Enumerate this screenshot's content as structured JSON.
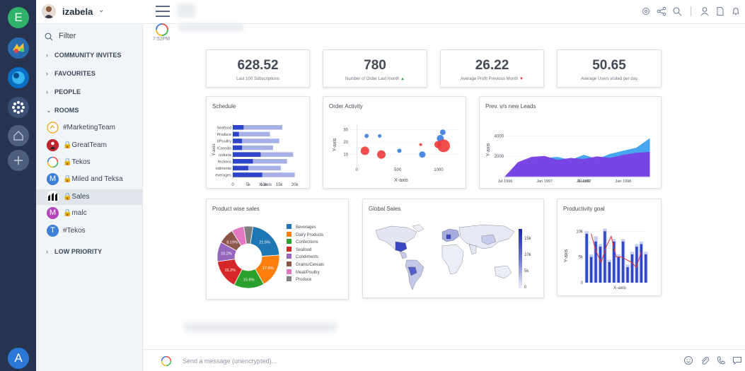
{
  "rail": {
    "top_space_letter": "E",
    "bottom_space_letter": "A",
    "colors": {
      "top_space": "#2fb36b",
      "bottom_space": "#2b78d6"
    }
  },
  "user": {
    "name": "izabela"
  },
  "filter": {
    "label": "Filter"
  },
  "sections": {
    "community_invites": "COMMUNITY INVITES",
    "favourites": "FAVOURITES",
    "people": "PEOPLE",
    "rooms": "ROOMS",
    "low_priority": "LOW PRIORITY"
  },
  "rooms": [
    {
      "name": "#MarketingTeam",
      "avatar_letter": "",
      "color": "#f5a524",
      "locked": false
    },
    {
      "name": "GreatTeam",
      "avatar_letter": "",
      "color": "#d02e2e",
      "locked": true
    },
    {
      "name": "Tekos",
      "avatar_letter": "",
      "color": "#4a90d9",
      "locked": true
    },
    {
      "name": "Miled and Teksa",
      "avatar_letter": "M",
      "color": "#3e7fd8",
      "locked": true
    },
    {
      "name": "Sales",
      "avatar_letter": "",
      "color": "#1c1c1c",
      "locked": true,
      "selected": true
    },
    {
      "name": "malc",
      "avatar_letter": "M",
      "color": "#b245b8",
      "locked": true
    },
    {
      "name": "#Tekos",
      "avatar_letter": "T",
      "color": "#3e7fd8",
      "locked": false
    }
  ],
  "timeline": {
    "time": "7:52PM"
  },
  "kpis": [
    {
      "value": "628.52",
      "label": "Last 100 Subscriptions",
      "trend": ""
    },
    {
      "value": "780",
      "label": "Number of Order Last month",
      "trend": "▲"
    },
    {
      "value": "26.22",
      "label": "Average Profit Previous Month",
      "trend": "▼"
    },
    {
      "value": "50.65",
      "label": "Average Users visited per day",
      "trend": ""
    }
  ],
  "charts": {
    "schedule": {
      "title": "Schedule",
      "ylabel": "Y-axis",
      "xlabel": "X-axis",
      "categories": [
        "Seafood",
        "Produce",
        "t/Poultry",
        "/Cereals",
        "roducts",
        "fections",
        "ndiments",
        "everages"
      ],
      "x_ticks": [
        "0",
        "5k",
        "10k",
        "15k",
        "20k"
      ]
    },
    "order_activity": {
      "title": "Order Activity",
      "ylabel": "Y-axis",
      "xlabel": "X-axis",
      "y_ticks": [
        "30",
        "20",
        "10"
      ],
      "x_ticks": [
        "0",
        "500",
        "1000"
      ]
    },
    "leads": {
      "title": "Prev. v/s new Leads",
      "ylabel": "Y-axis",
      "xlabel": "X-axis",
      "y_ticks": [
        "4000",
        "2000"
      ],
      "x_ticks": [
        "Jul 1996",
        "Jan 1997",
        "Jul 1997",
        "Jan 1998"
      ]
    },
    "product_sales": {
      "title": "Product wise sales",
      "legend": [
        "Beverages",
        "Dairy Products",
        "Confections",
        "Seafood",
        "Condiments",
        "Grains/Cereals",
        "Meat/Poultry",
        "Produce"
      ],
      "slice_labels": [
        "21.5%",
        "17.8%",
        "15.9%",
        "15.2%",
        "10.2%",
        "8.19%",
        "",
        ""
      ],
      "colors": [
        "#1f77b4",
        "#ff7f0e",
        "#2ca02c",
        "#d62728",
        "#9467bd",
        "#8c564b",
        "#e377c2",
        "#7f7f7f"
      ]
    },
    "global_sales": {
      "title": "Global Sales",
      "scale_ticks": [
        "15k",
        "10k",
        "5k",
        "0"
      ]
    },
    "productivity": {
      "title": "Productivity goal",
      "ylabel": "Y-axis",
      "xlabel": "X-axis",
      "y_ticks": [
        "10k",
        "5k",
        "0"
      ]
    }
  },
  "chart_data": [
    {
      "type": "bar",
      "title": "Schedule",
      "xlabel": "X-axis",
      "ylabel": "Y-axis",
      "orientation": "horizontal",
      "categories": [
        "Seafood",
        "Produce",
        "t/Poultry",
        "/Cereals",
        "roducts",
        "fections",
        "ndiments",
        "everages"
      ],
      "series": [
        {
          "values": [
            3500,
            2000,
            3000,
            3000,
            9000,
            6500,
            5000,
            9500
          ]
        },
        {
          "values": [
            16000,
            12000,
            15000,
            13000,
            19500,
            17500,
            15500,
            20000
          ]
        }
      ],
      "xlim": [
        0,
        21000
      ],
      "colors": [
        "#2e45c8",
        "#a7b1e6"
      ]
    },
    {
      "type": "scatter",
      "title": "Order Activity",
      "xlabel": "X-axis",
      "ylabel": "Y-axis",
      "xlim": [
        -80,
        1250
      ],
      "ylim": [
        0,
        35
      ],
      "points": [
        {
          "x": 120,
          "y": 25,
          "size": 3,
          "color": "#3b7ddd"
        },
        {
          "x": 280,
          "y": 25,
          "size": 2.5,
          "color": "#3b7ddd"
        },
        {
          "x": 100,
          "y": 13,
          "size": 6,
          "color": "#ef3b3b"
        },
        {
          "x": 300,
          "y": 10,
          "size": 6,
          "color": "#ef3b3b"
        },
        {
          "x": 520,
          "y": 13,
          "size": 3,
          "color": "#3b7ddd"
        },
        {
          "x": 780,
          "y": 18,
          "size": 2,
          "color": "#ef3b3b"
        },
        {
          "x": 800,
          "y": 10,
          "size": 4.5,
          "color": "#3b7ddd"
        },
        {
          "x": 1050,
          "y": 28,
          "size": 4,
          "color": "#3b7ddd"
        },
        {
          "x": 1020,
          "y": 23,
          "size": 5,
          "color": "#3b7ddd"
        },
        {
          "x": 1060,
          "y": 17,
          "size": 9,
          "color": "#ef3b3b"
        },
        {
          "x": 990,
          "y": 18,
          "size": 5,
          "color": "#ef3b3b"
        }
      ]
    },
    {
      "type": "area",
      "title": "Prev. v/s new Leads",
      "xlabel": "X-axis",
      "ylabel": "Y-axis",
      "x": [
        "Jul 1996",
        "Sep 1996",
        "Nov 1996",
        "Jan 1997",
        "Mar 1997",
        "May 1997",
        "Jul 1997",
        "Sep 1997",
        "Nov 1997",
        "Jan 1998",
        "Mar 1998",
        "May 1998"
      ],
      "series": [
        {
          "values": [
            0,
            1300,
            1700,
            1800,
            1900,
            1600,
            2100,
            1700,
            2200,
            2500,
            2800,
            3700
          ],
          "color": "#3da1ee"
        },
        {
          "values": [
            0,
            1400,
            1900,
            2000,
            1600,
            1800,
            1700,
            1950,
            1800,
            2100,
            2300,
            2400
          ],
          "color": "#7b3fe4"
        }
      ],
      "ylim": [
        0,
        5200
      ]
    },
    {
      "type": "pie",
      "title": "Product wise sales",
      "categories": [
        "Beverages",
        "Dairy Products",
        "Confections",
        "Seafood",
        "Condiments",
        "Grains/Cereals",
        "Meat/Poultry",
        "Produce"
      ],
      "values": [
        21.5,
        17.8,
        15.9,
        15.2,
        10.2,
        8.19,
        6.5,
        4.71
      ],
      "donut": true
    },
    {
      "type": "heatmap",
      "title": "Global Sales",
      "colorscale_range": [
        0,
        15000
      ]
    },
    {
      "type": "bar",
      "title": "Productivity goal",
      "xlabel": "X-axis",
      "ylabel": "Y-axis",
      "ylim": [
        0,
        11000
      ],
      "series": [
        {
          "values": [
            10000,
            5500,
            9000,
            7500,
            10500,
            4500,
            8500,
            5500,
            8500,
            3500,
            6000,
            7500,
            8000,
            6000
          ],
          "color": "#c5cdf2"
        },
        {
          "values": [
            9500,
            5000,
            8000,
            7000,
            10000,
            4000,
            8000,
            5000,
            8000,
            3000,
            5500,
            7000,
            7500,
            5500
          ],
          "color": "#2e45c8"
        }
      ],
      "line": {
        "values": [
          9500,
          6000,
          4000,
          7000,
          9000,
          5000,
          5000,
          4500,
          4000,
          3000,
          6000
        ],
        "color": "#e03131"
      }
    }
  ],
  "composer": {
    "placeholder": "Send a message (unencrypted)..."
  }
}
